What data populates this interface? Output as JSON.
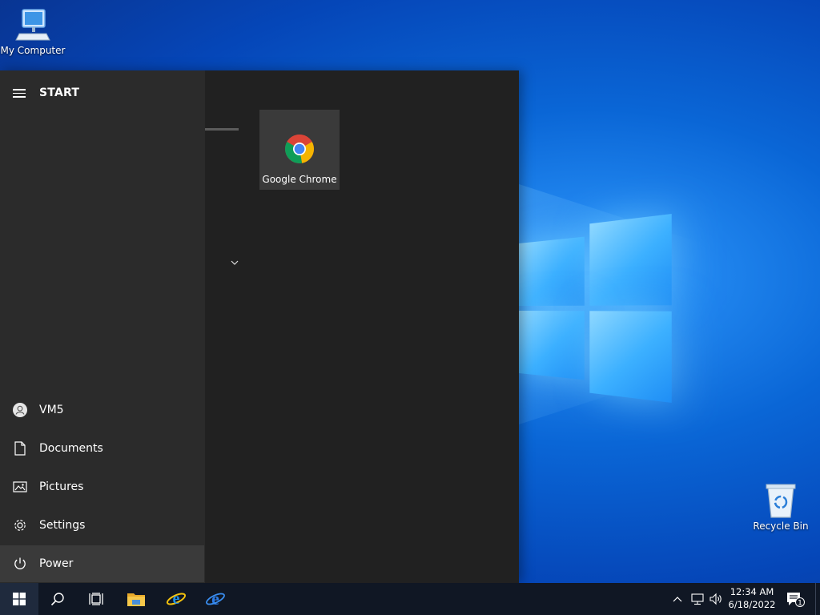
{
  "desktop": {
    "icons": [
      {
        "label": "My Computer"
      },
      {
        "label": "Recycle Bin"
      }
    ]
  },
  "start_menu": {
    "title": "START",
    "side_items": [
      {
        "label": "VM5",
        "icon": "user-icon"
      },
      {
        "label": "Documents",
        "icon": "document-icon"
      },
      {
        "label": "Pictures",
        "icon": "pictures-icon"
      },
      {
        "label": "Settings",
        "icon": "gear-icon"
      },
      {
        "label": "Power",
        "icon": "power-icon"
      }
    ],
    "tiles": [
      {
        "label": "Google Chrome",
        "icon": "chrome-icon"
      }
    ]
  },
  "taskbar": {
    "pinned": [
      "start-icon",
      "search-icon",
      "task-view-icon",
      "file-explorer-icon",
      "internet-explorer-icon",
      "internet-explorer-icon"
    ],
    "clock": {
      "time": "12:34 AM",
      "date": "6/18/2022"
    },
    "notification_count": "1"
  },
  "colors": {
    "start_bg": "#212121",
    "start_left_bg": "#2b2b2b",
    "taskbar_bg": "#101724",
    "accent": "#0a66d6"
  }
}
